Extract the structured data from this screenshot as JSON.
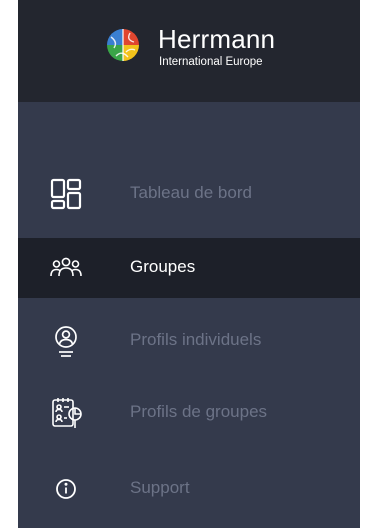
{
  "brand": {
    "name": "Herrmann",
    "subtitle": "International Europe",
    "logo_icon": "brain-quadrant-logo"
  },
  "nav": {
    "items": [
      {
        "label": "Tableau de bord",
        "icon": "dashboard-grid-icon",
        "active": false
      },
      {
        "label": "Groupes",
        "icon": "group-people-icon",
        "active": true
      },
      {
        "label": "Profils individuels",
        "icon": "user-profile-icon",
        "active": false
      },
      {
        "label": "Profils de groupes",
        "icon": "group-profile-clipboard-icon",
        "active": false
      },
      {
        "label": "Support",
        "icon": "info-circle-icon",
        "active": false
      }
    ]
  },
  "colors": {
    "sidebar_bg": "#343a4c",
    "header_bg": "#23262f",
    "active_bg": "#1d2029",
    "inactive_text": "#6c7387",
    "active_text": "#ffffff"
  }
}
